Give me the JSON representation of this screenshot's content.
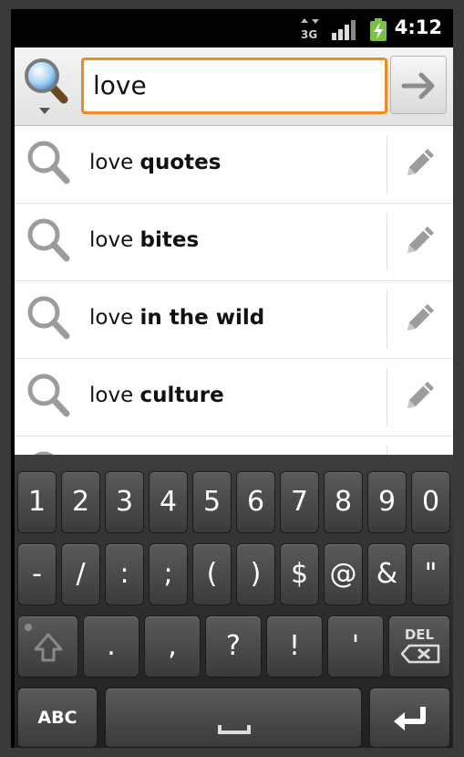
{
  "status_bar": {
    "network": "3G",
    "time": "4:12"
  },
  "search": {
    "query": "love"
  },
  "suggestions": [
    {
      "prefix": "love",
      "suffix": "quotes"
    },
    {
      "prefix": "love",
      "suffix": "bites"
    },
    {
      "prefix": "love",
      "suffix": "in the wild"
    },
    {
      "prefix": "love",
      "suffix": "culture"
    }
  ],
  "keyboard": {
    "row1": [
      "1",
      "2",
      "3",
      "4",
      "5",
      "6",
      "7",
      "8",
      "9",
      "0"
    ],
    "row2": [
      "-",
      "/",
      ":",
      ";",
      "(",
      ")",
      "$",
      "@",
      "&",
      "\""
    ],
    "row3": [
      ".",
      ",",
      "?",
      "!",
      "'"
    ],
    "shift_label": "",
    "del_label": "DEL",
    "abc_label": "ABC"
  },
  "colors": {
    "focus_border": "#ef8a1e",
    "battery": "#7ac143"
  }
}
